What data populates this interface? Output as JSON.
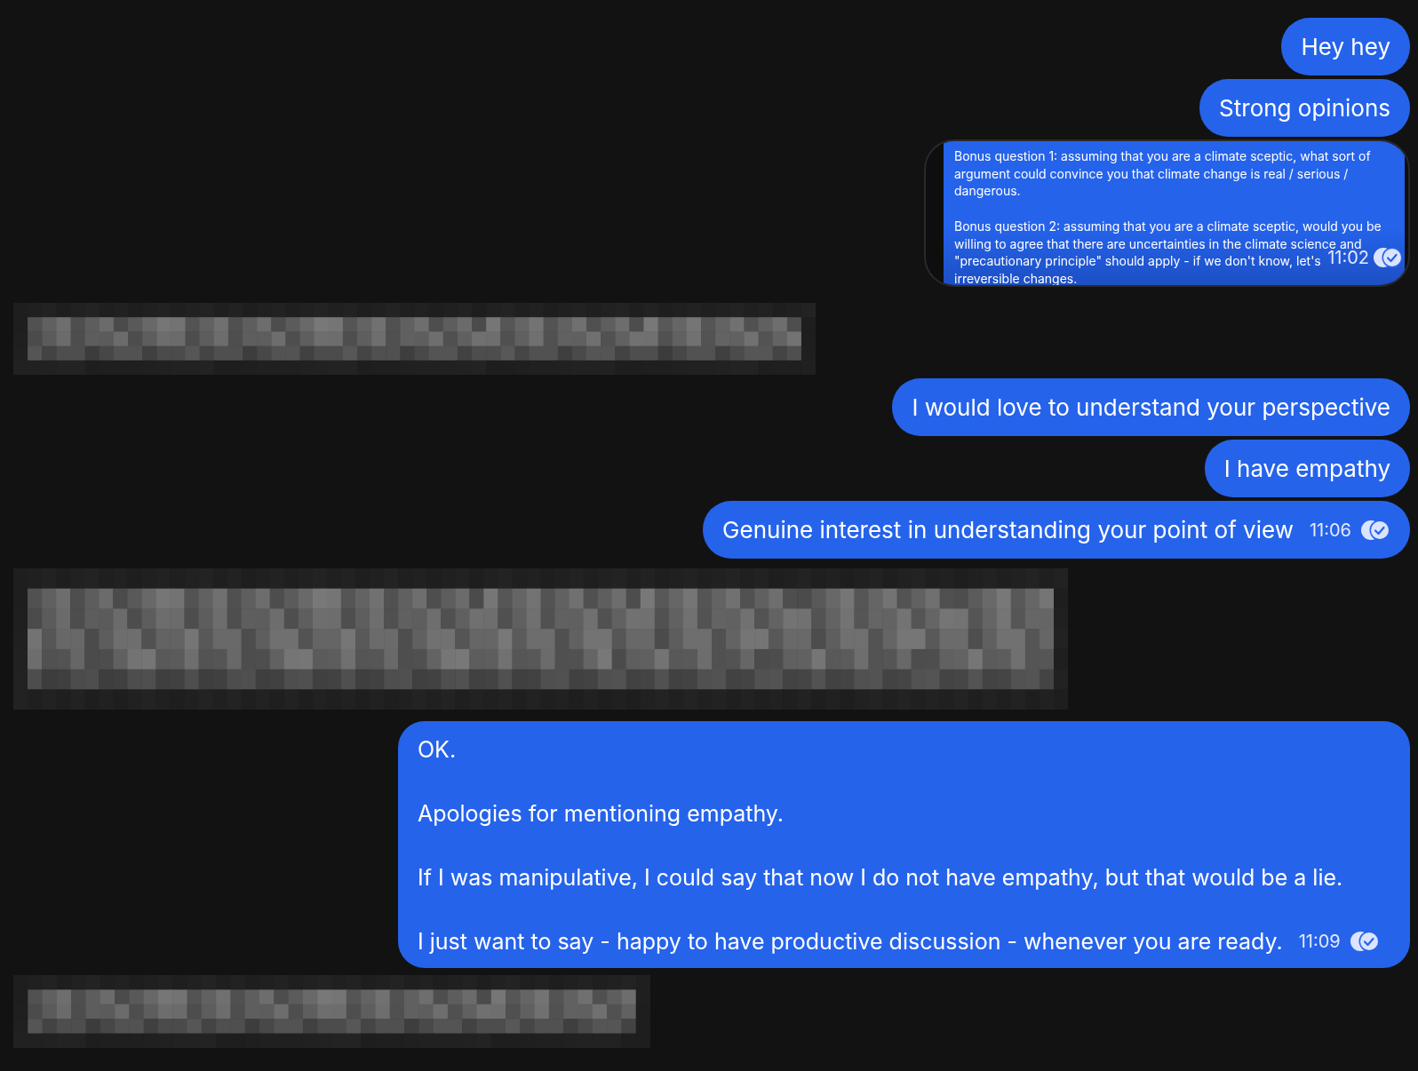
{
  "messages": [
    {
      "kind": "text",
      "paragraphs": [
        "Hey hey"
      ]
    },
    {
      "kind": "text",
      "paragraphs": [
        "Strong opinions"
      ]
    },
    {
      "kind": "quoted",
      "paragraphs": [
        "Bonus question 1: assuming that you are a climate sceptic, what sort of\nargument could convince you that climate change is real / serious /\ndangerous.",
        "Bonus question 2: assuming that you are a climate sceptic, would you be\nwilling to agree that there are uncertainties in the climate science and\n\"precautionary principle\" should apply - if we don't know, let's\nirreversible changes."
      ],
      "time": "11:02",
      "read": true
    },
    {
      "kind": "redacted"
    },
    {
      "kind": "text",
      "paragraphs": [
        "I would love to understand your perspective"
      ]
    },
    {
      "kind": "text",
      "paragraphs": [
        "I have empathy"
      ]
    },
    {
      "kind": "text",
      "paragraphs": [
        "Genuine interest in understanding your point of view"
      ],
      "time": "11:06",
      "read": true
    },
    {
      "kind": "redacted"
    },
    {
      "kind": "text",
      "paragraphs": [
        "OK.",
        "Apologies for mentioning empathy.",
        "If I was manipulative, I could say that now I do not have empathy, but that would be a lie.",
        "I just want to say - happy to have productive discussion - whenever you are ready."
      ],
      "time": "11:09",
      "read": true
    },
    {
      "kind": "redacted"
    }
  ]
}
